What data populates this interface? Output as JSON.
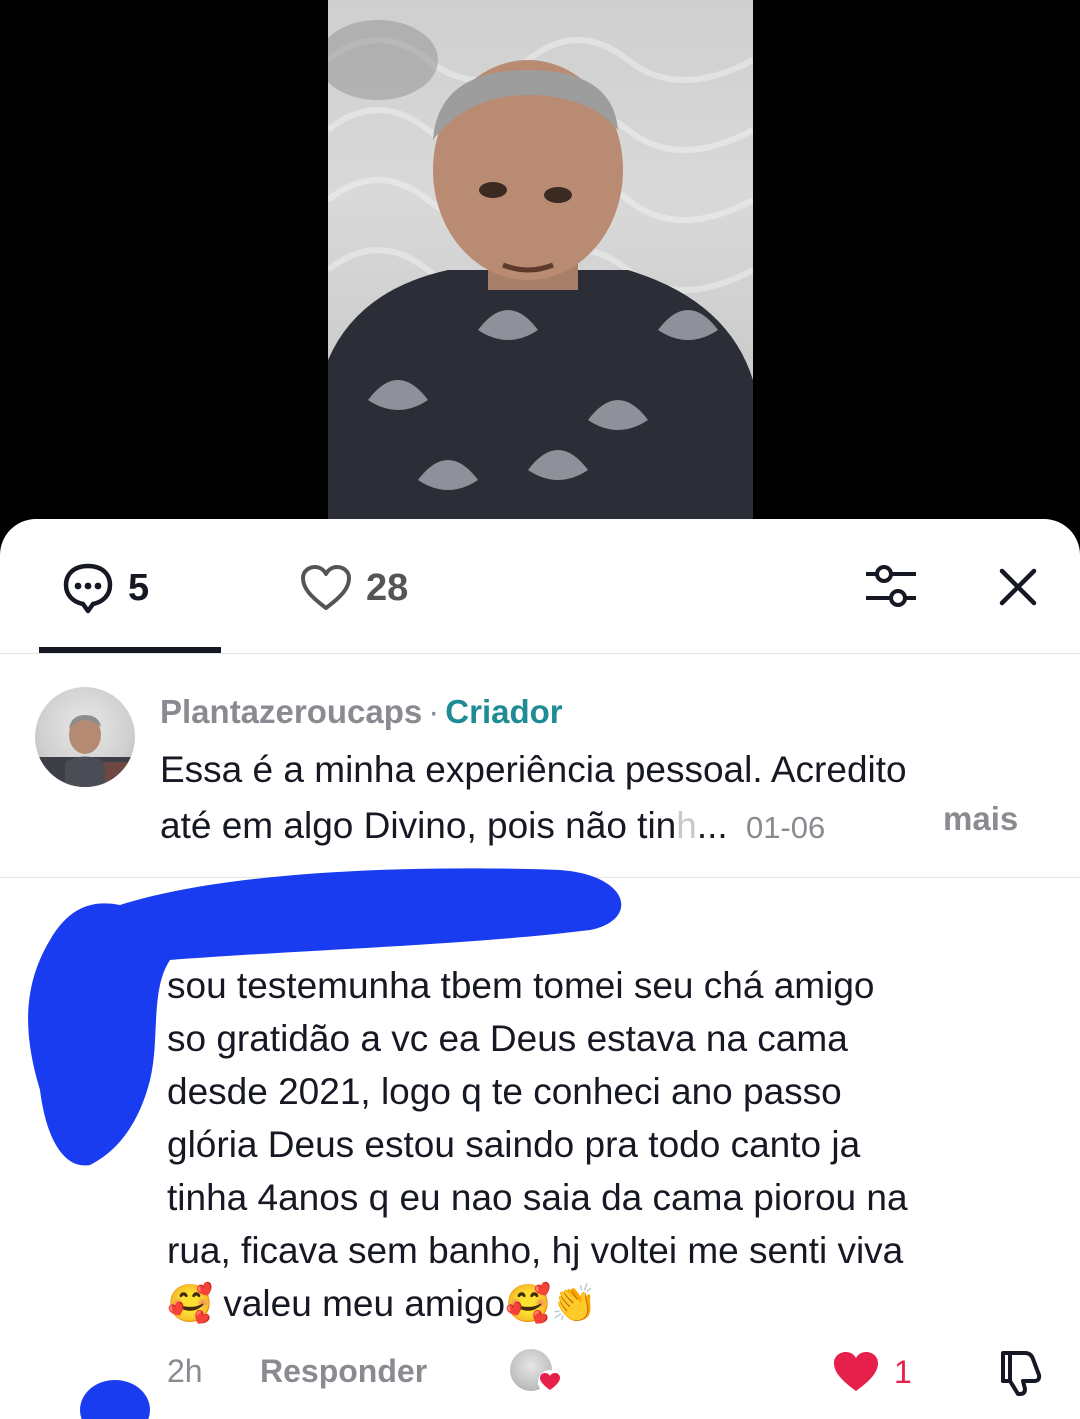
{
  "tabs": {
    "comments_count": "5",
    "likes_count": "28"
  },
  "comment1": {
    "username": "Plantazeroucaps",
    "dot": "·",
    "badge": "Criador",
    "text_line1": "Essa é a minha experiência pessoal. Acredito",
    "text_line2_start": "até em algo Divino, pois não tin",
    "text_line2_fade": "h",
    "ellipsis": "...",
    "date": "01-06",
    "more": "mais"
  },
  "comment2": {
    "lines": [
      "sou testemunha tbem tomei seu chá amigo",
      "so gratidão a vc ea Deus estava na cama",
      "desde 2021, logo q te conheci ano passo",
      "glória Deus estou saindo pra todo canto ja",
      "tinha 4anos q eu nao saia da cama piorou na",
      "rua, ficava sem banho, hj voltei me senti viva"
    ],
    "last_line_emoji1": "🥰",
    "last_line_text": " valeu meu amigo",
    "last_line_emoji2": "🥰👏",
    "time": "2h",
    "reply": "Responder",
    "like_count": "1"
  },
  "icons": {
    "comment": "comment-bubble-icon",
    "like": "heart-outline-icon",
    "filter": "sliders-icon",
    "close": "close-icon",
    "liked": "heart-filled-icon",
    "dislike": "thumbs-down-icon"
  },
  "colors": {
    "creator_badge": "#1f8b94",
    "like_red": "#e6204b",
    "redaction_blue": "#1a3cf0"
  }
}
